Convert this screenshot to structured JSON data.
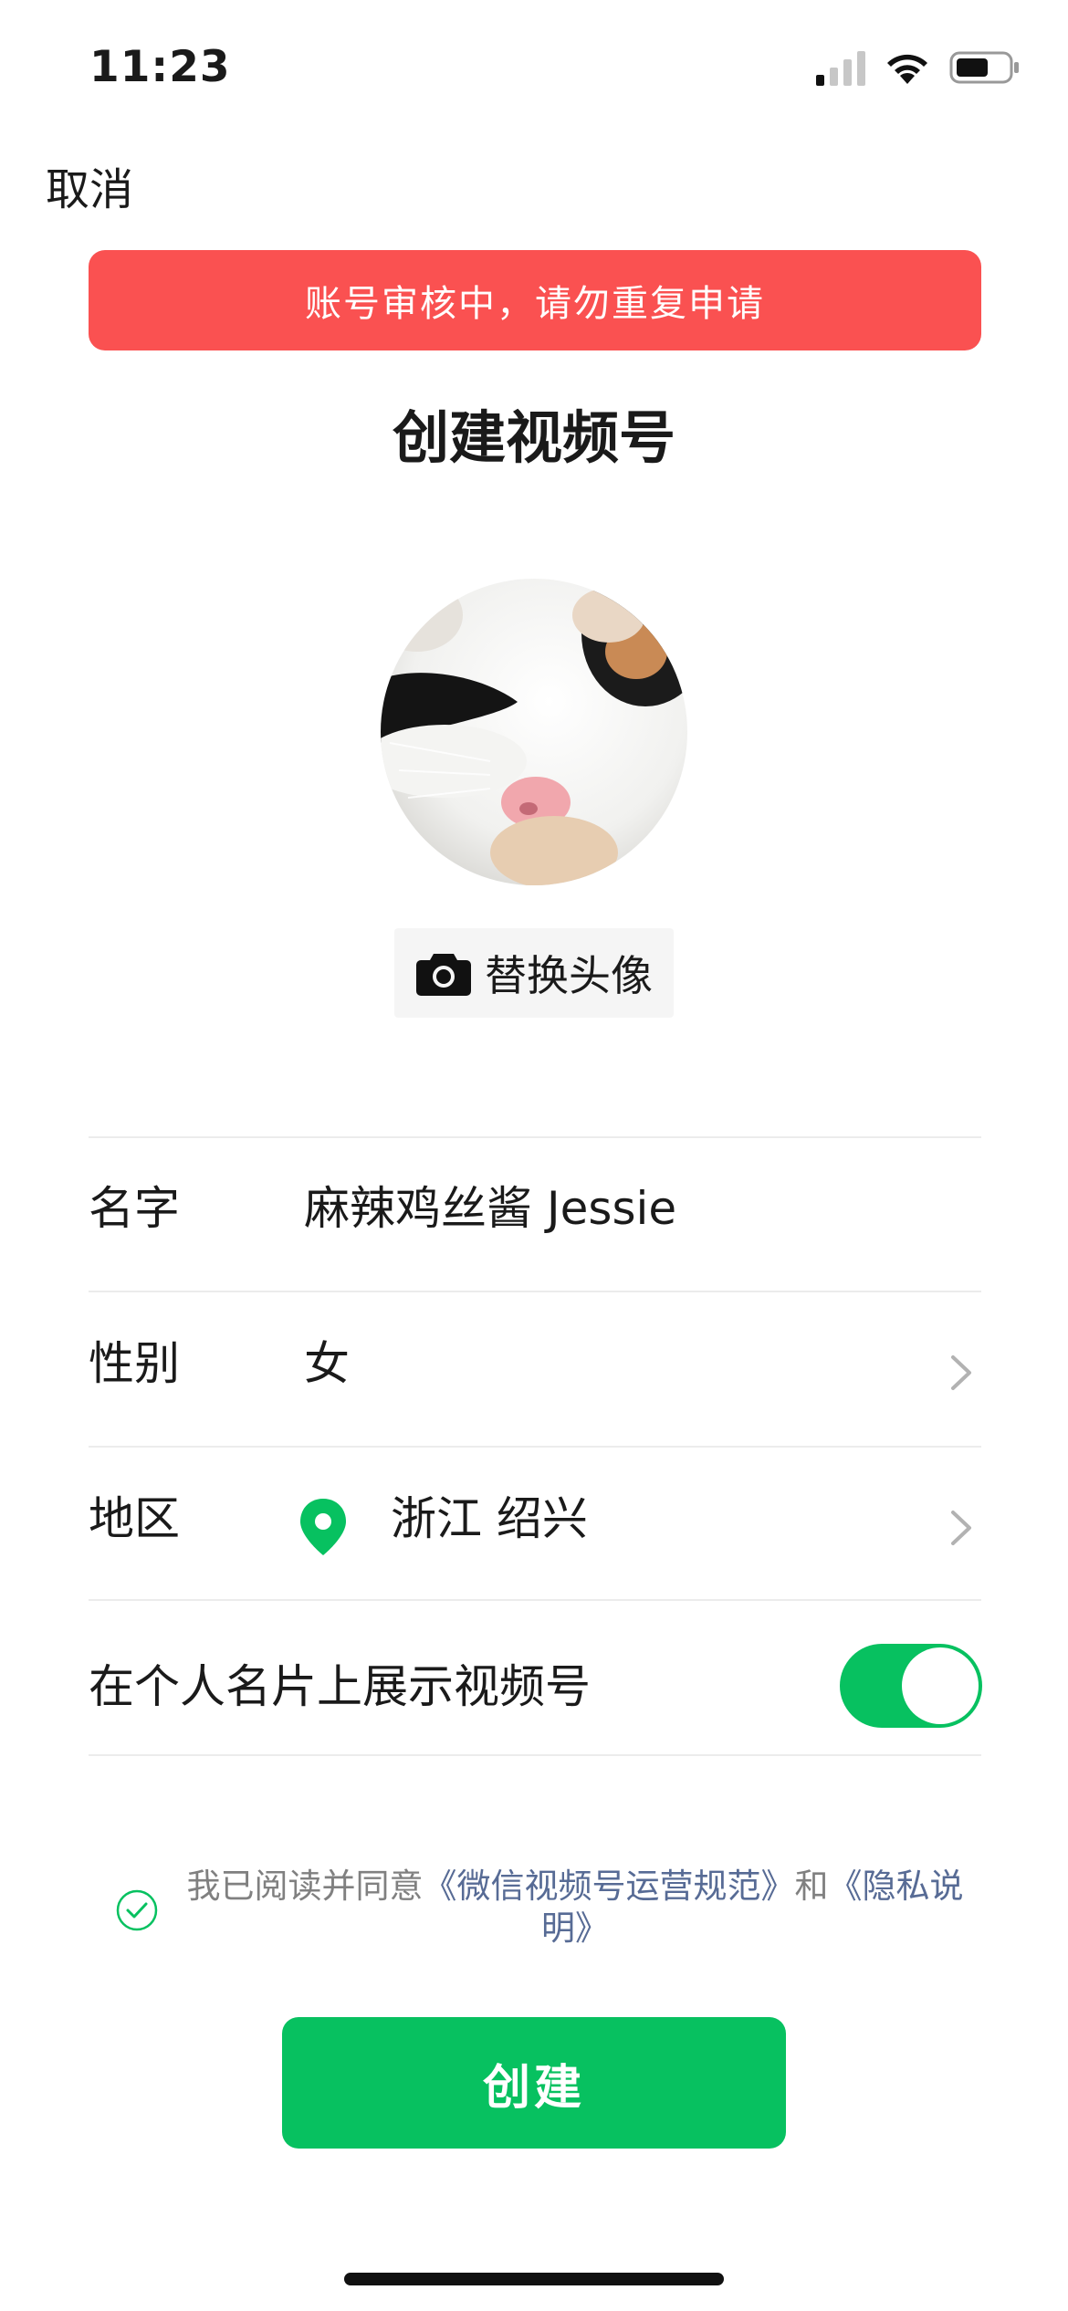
{
  "status_bar": {
    "time": "11:23",
    "icons": [
      "cellular-signal-icon",
      "wifi-icon",
      "battery-icon"
    ]
  },
  "nav": {
    "cancel_label": "取消"
  },
  "alert": {
    "text": "账号审核中，请勿重复申请",
    "color": "#fa5151"
  },
  "title": "创建视频号",
  "avatar": {
    "replace_label": "替换头像",
    "icon": "camera-icon"
  },
  "form": {
    "name": {
      "label": "名字",
      "value": "麻辣鸡丝酱 Jessie"
    },
    "gender": {
      "label": "性别",
      "value": "女"
    },
    "region": {
      "label": "地区",
      "value": "浙江 绍兴",
      "icon": "location-pin-icon"
    },
    "show_on_card": {
      "label": "在个人名片上展示视频号",
      "enabled": true
    }
  },
  "agreement": {
    "checked": true,
    "prefix": "我已阅读并同意",
    "link1": "《微信视频号运营规范》",
    "middle": "和",
    "link2_part1": "《隐私说",
    "link2_part2": "明》"
  },
  "create_button": {
    "label": "创建",
    "color": "#07c160"
  },
  "accent_color": "#07c160",
  "link_color": "#576b95"
}
